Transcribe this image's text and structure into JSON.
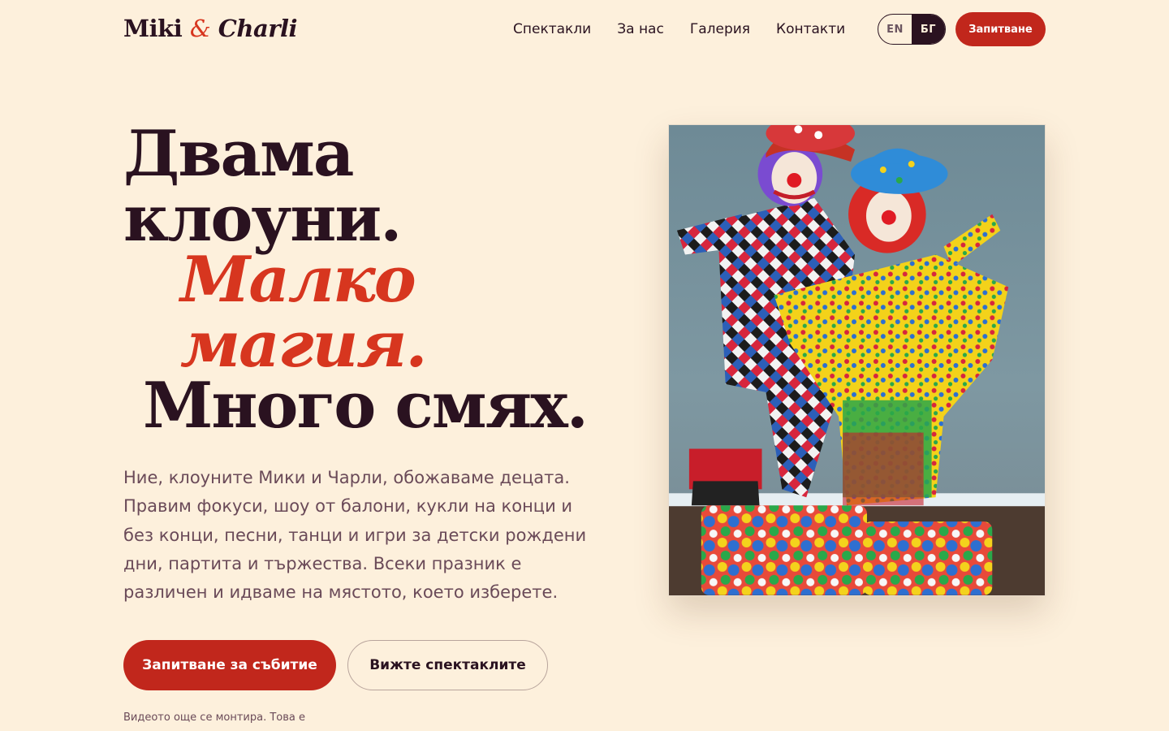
{
  "brand": {
    "part1": "Miki",
    "amp": "&",
    "part2": "Charli"
  },
  "nav": [
    "Спектакли",
    "За нас",
    "Галерия",
    "Контакти"
  ],
  "lang": {
    "en": "EN",
    "bg": "БГ"
  },
  "cta_top": "Запитване",
  "headline": {
    "line1": "Двама",
    "line2": "клоуни.",
    "line3": "Малко",
    "line4": "магия.",
    "line5": "Много смях."
  },
  "lead": "Ние, клоуните Мики и Чарли, обожаваме децата. Правим фокуси, шоу от балони, кукли на конци и без конци, песни, танци и игри за детски рождени дни, партита и тържества. Всеки празник е различен и идваме на мястото, което изберете.",
  "buttons": {
    "primary": "Запитване за събитие",
    "secondary": "Вижте спектаклите"
  },
  "footnote": "Видеото още се монтира. Това е",
  "colors": {
    "background": "#fdf0dc",
    "accent": "#d7361f",
    "button": "#c1271c",
    "ink": "#2a1220"
  }
}
